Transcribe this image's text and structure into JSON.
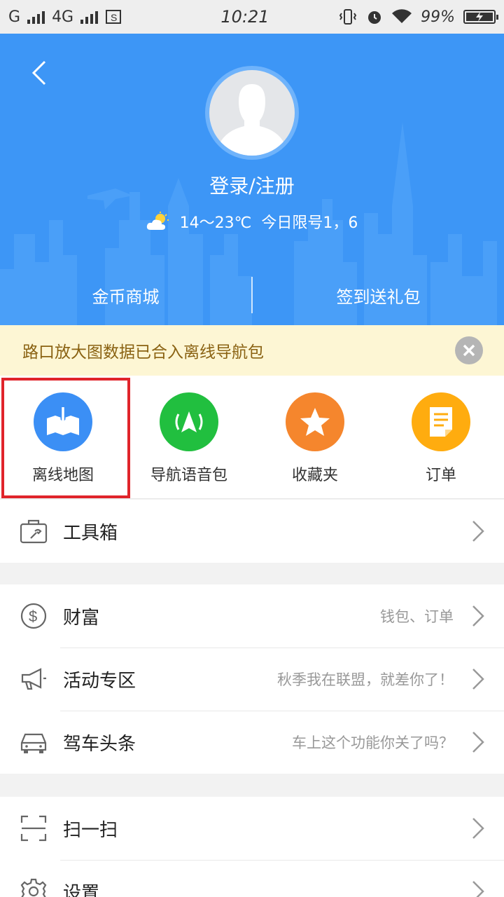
{
  "status_bar": {
    "carrier": "G",
    "network": "4G",
    "time": "10:21",
    "battery": "99%",
    "battery_level": 0.99
  },
  "header": {
    "login_label": "登录/注册",
    "weather_temp": "14～23℃",
    "weather_limit": "今日限号1，6",
    "actions": [
      {
        "label": "金币商城"
      },
      {
        "label": "签到送礼包"
      }
    ]
  },
  "notice": {
    "text": "路口放大图数据已合入离线导航包"
  },
  "quick_actions": [
    {
      "label": "离线地图",
      "icon": "offline-map-icon",
      "color": "#3b8ff5"
    },
    {
      "label": "导航语音包",
      "icon": "voice-pack-icon",
      "color": "#21bf3f"
    },
    {
      "label": "收藏夹",
      "icon": "star-icon",
      "color": "#f5862d"
    },
    {
      "label": "订单",
      "icon": "order-icon",
      "color": "#ffac0f"
    }
  ],
  "toolbox": {
    "title": "工具箱",
    "icon": "toolbox-icon"
  },
  "group2": [
    {
      "title": "财富",
      "subtitle": "钱包、订单",
      "icon": "dollar-icon"
    },
    {
      "title": "活动专区",
      "subtitle": "秋季我在联盟，就差你了！",
      "icon": "megaphone-icon"
    },
    {
      "title": "驾车头条",
      "subtitle": "车上这个功能你关了吗？",
      "icon": "car-icon"
    }
  ],
  "group3": [
    {
      "title": "扫一扫",
      "icon": "scan-icon"
    },
    {
      "title": "设置",
      "icon": "settings-icon"
    }
  ],
  "colors": {
    "header_blue": "#3d96f6",
    "notice_bg": "#fdf6d4",
    "notice_text": "#8a6212",
    "highlight_red": "#e0242b"
  }
}
